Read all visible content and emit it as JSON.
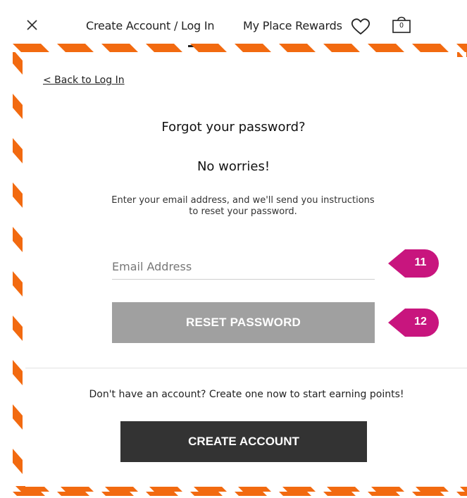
{
  "header": {
    "close_icon": "close-icon",
    "create_login_label": "Create Account / Log In",
    "rewards_label": "My Place Rewards",
    "wishlist_icon": "heart-icon",
    "bag_icon": "shopping-bag-icon",
    "bag_count": "0"
  },
  "form": {
    "back_link": "< Back to Log In",
    "title": "Forgot your password?",
    "subtitle": "No worries!",
    "description": "Enter your email address, and we'll send you instructions to reset your password.",
    "email_placeholder": "Email Address",
    "email_value": "",
    "reset_button": "RESET PASSWORD"
  },
  "signup": {
    "promo_text": "Don't have an account? Create one now to start earning points!",
    "create_button": "CREATE ACCOUNT"
  },
  "annotations": {
    "email_badge": "11",
    "reset_badge": "12"
  },
  "colors": {
    "stripe_orange": "#f26a10",
    "badge_magenta": "#c8157e",
    "reset_button_gray": "#a0a0a0",
    "create_button_dark": "#333333"
  }
}
